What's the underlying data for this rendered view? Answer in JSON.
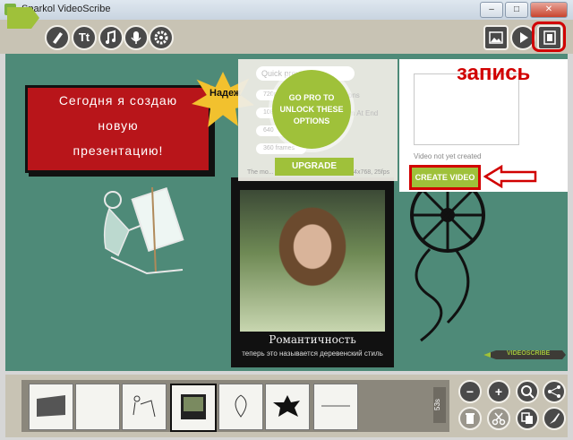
{
  "window": {
    "title": "Sparkol VideoScribe",
    "minimize": "‒",
    "maximize": "□",
    "close": "✕"
  },
  "toolbar": {
    "tools": [
      "pencil-icon",
      "text-icon",
      "music-icon",
      "microphone-icon",
      "gear-icon"
    ],
    "text_glyph": "Tt",
    "right": [
      "image-icon",
      "play-icon",
      "record-icon"
    ]
  },
  "canvas": {
    "banner_lines": [
      "Сегодня я создаю",
      "новую",
      "презентацию!"
    ],
    "splash_text": "Надеж",
    "photo_caption": "Романтичность",
    "photo_subcaption": "теперь это называется деревенский стиль",
    "pen_label": "VIDEOSCRIBE"
  },
  "settings": {
    "quick_label": "Quick preview",
    "rows": [
      "720p",
      "1080p",
      "640",
      "360 frames"
    ],
    "side_options": [
      "options",
      "Zoom At End"
    ],
    "note": "The mo... ...ck and was created at 1024x768, 25fps"
  },
  "pro": {
    "text": "GO PRO TO UNLOCK THESE OPTIONS",
    "upgrade": "UPGRADE"
  },
  "video": {
    "status": "Video not yet created",
    "create_button": "CREATE VIDEO"
  },
  "annotation": {
    "label": "запись"
  },
  "timeline": {
    "duration": "53s",
    "thumbs": [
      "shape-thumb",
      "blank-thumb",
      "sketch-thumb",
      "photo-thumb",
      "paisley-thumb",
      "splash-thumb",
      "text-thumb"
    ]
  },
  "bottom_controls": [
    "zoom-out-icon",
    "zoom-in-icon",
    "fit-icon",
    "share-icon",
    "trash-icon",
    "cut-icon",
    "copy-icon",
    "paint-icon"
  ],
  "colors": {
    "accent_green": "#9fc13a",
    "canvas": "#4e8a78",
    "banner_red": "#b8151a",
    "annotation_red": "#d10000"
  }
}
